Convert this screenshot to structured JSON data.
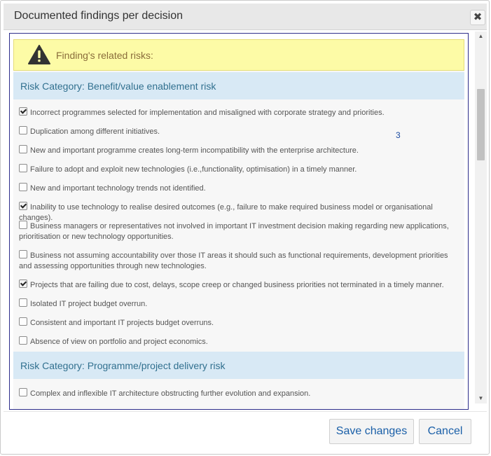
{
  "dialog": {
    "title": "Documented findings per decision",
    "close_glyph": "✖"
  },
  "warning": {
    "icon": "warning-triangle-icon",
    "text": "Finding's related risks:"
  },
  "categories": [
    {
      "label": "Risk Category: Benefit/value enablement risk",
      "items": [
        {
          "checked": true,
          "text": "Incorrect programmes selected for implementation and misaligned with corporate strategy and priorities."
        },
        {
          "checked": false,
          "text": "Duplication among different initiatives."
        },
        {
          "checked": false,
          "text": "New and important programme creates long-term incompatibility with the enterprise architecture."
        },
        {
          "checked": false,
          "text": "Failure to adopt and exploit new technologies (i.e.,functionality, optimisation) in a timely manner."
        },
        {
          "checked": false,
          "text": "New and important technology trends not identified."
        },
        {
          "checked": true,
          "text": "Inability to use technology to realise desired outcomes (e.g., failure to make required business model or organisational changes)."
        },
        {
          "checked": false,
          "text": "Business managers or representatives not involved in important IT investment decision making regarding new applications, prioritisation or new technology opportunities."
        },
        {
          "checked": false,
          "text": "Business not assuming accountability over those IT areas it should such as functional requirements, development priorities and assessing opportunities through new technologies."
        },
        {
          "checked": true,
          "text": "Projects that are failing due to cost, delays, scope creep or changed business priorities not terminated in a timely manner."
        },
        {
          "checked": false,
          "text": "Isolated IT project budget overrun."
        },
        {
          "checked": false,
          "text": "Consistent and important IT projects budget overruns."
        },
        {
          "checked": false,
          "text": "Absence of view on portfolio and project economics."
        }
      ]
    },
    {
      "label": "Risk Category: Programme/project delivery risk",
      "items": [
        {
          "checked": false,
          "text": "Complex and inflexible IT architecture obstructing further evolution and expansion."
        }
      ]
    }
  ],
  "annotation": "3",
  "scrollbar": {
    "up_glyph": "▲",
    "down_glyph": "▼",
    "position_fraction": 0.16
  },
  "footer": {
    "save_label": "Save changes",
    "cancel_label": "Cancel"
  },
  "colors": {
    "accent_link": "#1a5fa8",
    "category_bg": "#d8e9f5",
    "warning_bg": "#fdfba6",
    "frame_border": "#2d2d8a"
  }
}
